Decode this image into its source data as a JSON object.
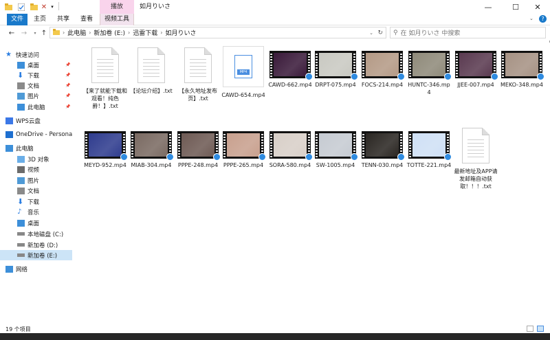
{
  "titlebar": {
    "context_tab": "播放",
    "title": "如月りいさ",
    "minimize": "—",
    "maximize": "☐",
    "close": "✕",
    "help": "?"
  },
  "ribbon": {
    "tabs": [
      "文件",
      "主页",
      "共享",
      "查看"
    ],
    "context_tab": "视频工具"
  },
  "address": {
    "crumbs": [
      "此电脑",
      "新加卷 (E:)",
      "迅雷下载",
      "如月りいさ"
    ],
    "search_placeholder": "在 如月りいさ 中搜索"
  },
  "nav": {
    "items": [
      {
        "label": "快速访问",
        "icon": "star-icon",
        "pinned": false
      },
      {
        "label": "桌面",
        "icon": "desktop-icon",
        "pinned": true
      },
      {
        "label": "下载",
        "icon": "download-icon",
        "pinned": true
      },
      {
        "label": "文档",
        "icon": "document-icon",
        "pinned": true
      },
      {
        "label": "图片",
        "icon": "picture-icon",
        "pinned": true
      },
      {
        "label": "此电脑",
        "icon": "pc-icon",
        "pinned": true
      },
      {
        "label": "WPS云盘",
        "icon": "cloud-icon",
        "pinned": false
      },
      {
        "label": "OneDrive - Persona",
        "icon": "onedrive-icon",
        "pinned": false
      },
      {
        "label": "此电脑",
        "icon": "pc-icon",
        "pinned": false
      },
      {
        "label": "3D 对象",
        "icon": "cube-icon",
        "pinned": false
      },
      {
        "label": "视频",
        "icon": "video-icon",
        "pinned": false
      },
      {
        "label": "图片",
        "icon": "picture-icon",
        "pinned": false
      },
      {
        "label": "文档",
        "icon": "document-icon",
        "pinned": false
      },
      {
        "label": "下载",
        "icon": "download-icon",
        "pinned": false
      },
      {
        "label": "音乐",
        "icon": "music-icon",
        "pinned": false
      },
      {
        "label": "桌面",
        "icon": "desktop-icon",
        "pinned": false
      },
      {
        "label": "本地磁盘 (C:)",
        "icon": "drive-icon",
        "pinned": false
      },
      {
        "label": "新加卷 (D:)",
        "icon": "drive-icon",
        "pinned": false
      },
      {
        "label": "新加卷 (E:)",
        "icon": "drive-icon",
        "pinned": false,
        "selected": true
      },
      {
        "label": "网络",
        "icon": "network-icon",
        "pinned": false
      }
    ]
  },
  "files": [
    {
      "name": "【来了就能下载和观看！纯色爵！】.txt",
      "type": "txt"
    },
    {
      "name": "【论坛介绍】.txt",
      "type": "txt"
    },
    {
      "name": "【永久地址发布页】.txt",
      "type": "txt"
    },
    {
      "name": "CAWD-654.mp4",
      "type": "mp4-icon"
    },
    {
      "name": "CAWD-662.mp4",
      "type": "video",
      "color": "#3a1a3a"
    },
    {
      "name": "DRPT-075.mp4",
      "type": "video",
      "color": "#c9c9c2"
    },
    {
      "name": "FOCS-214.mp4",
      "type": "video",
      "color": "#b49a86"
    },
    {
      "name": "HUNTC-346.mp4",
      "type": "video",
      "color": "#8f8a7a"
    },
    {
      "name": "JJEE-007.mp4",
      "type": "video",
      "color": "#5a3a50"
    },
    {
      "name": "MEKO-348.mp4",
      "type": "video",
      "color": "#a69284"
    },
    {
      "name": "MEYD-952.mp4",
      "type": "video",
      "color": "#2f3c8e"
    },
    {
      "name": "MIAB-304.mp4",
      "type": "video",
      "color": "#7a6a62"
    },
    {
      "name": "PPPE-248.mp4",
      "type": "video",
      "color": "#6e5a54"
    },
    {
      "name": "PPPE-265.mp4",
      "type": "video",
      "color": "#c8a08e"
    },
    {
      "name": "SORA-580.mp4",
      "type": "video",
      "color": "#d8cfc8"
    },
    {
      "name": "SW-1005.mp4",
      "type": "video",
      "color": "#c6cbd2"
    },
    {
      "name": "TENN-030.mp4",
      "type": "video",
      "color": "#2a2622"
    },
    {
      "name": "TOTTE-221.mp4",
      "type": "video",
      "color": "#cfe0f5"
    },
    {
      "name": "最新地址及APP请发邮箱自动获取！！！.txt",
      "type": "txt"
    }
  ],
  "status": {
    "count": "19 个项目"
  }
}
